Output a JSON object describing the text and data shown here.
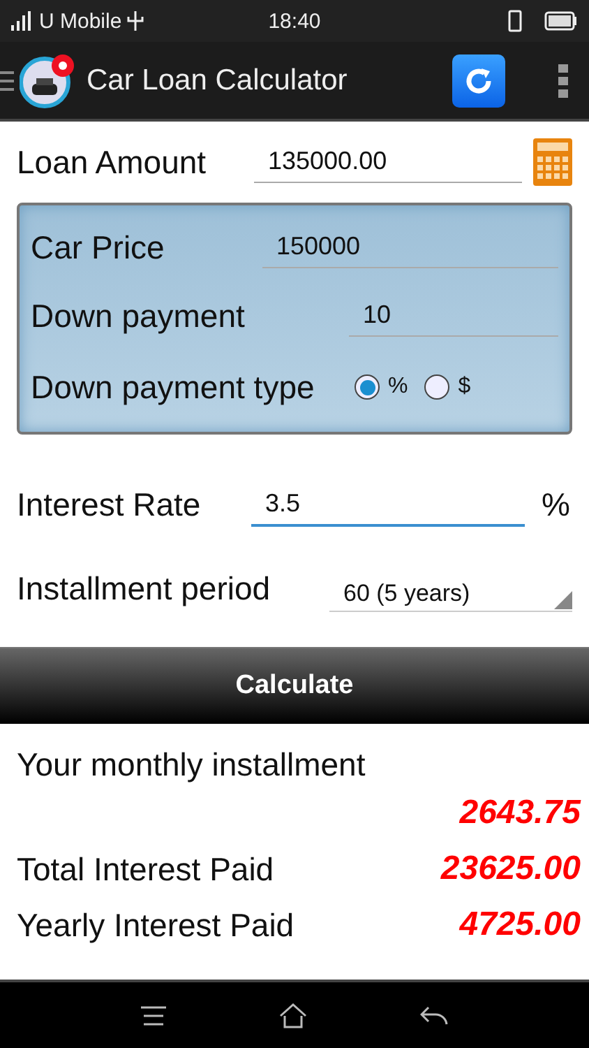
{
  "status_bar": {
    "carrier": "U Mobile",
    "time": "18:40"
  },
  "app_bar": {
    "title": "Car Loan Calculator"
  },
  "loan_amount": {
    "label": "Loan Amount",
    "value": "135000.00"
  },
  "car_price": {
    "label": "Car Price",
    "value": "150000"
  },
  "down_payment": {
    "label": "Down payment",
    "value": "10"
  },
  "down_payment_type": {
    "label": "Down payment type",
    "options": [
      {
        "label": "%",
        "selected": true
      },
      {
        "label": "$",
        "selected": false
      }
    ]
  },
  "interest_rate": {
    "label": "Interest Rate",
    "value": "3.5",
    "unit": "%",
    "focused": true
  },
  "installment_period": {
    "label": "Installment period",
    "value": "60 (5 years)"
  },
  "calculate_button": "Calculate",
  "results": [
    {
      "label": "Your monthly installment",
      "value": "2643.75",
      "kind": "stacked"
    },
    {
      "label": "Total Interest Paid",
      "value": "23625.00",
      "kind": "inline"
    },
    {
      "label": "Yearly Interest Paid",
      "value": "4725.00",
      "kind": "inline"
    }
  ]
}
